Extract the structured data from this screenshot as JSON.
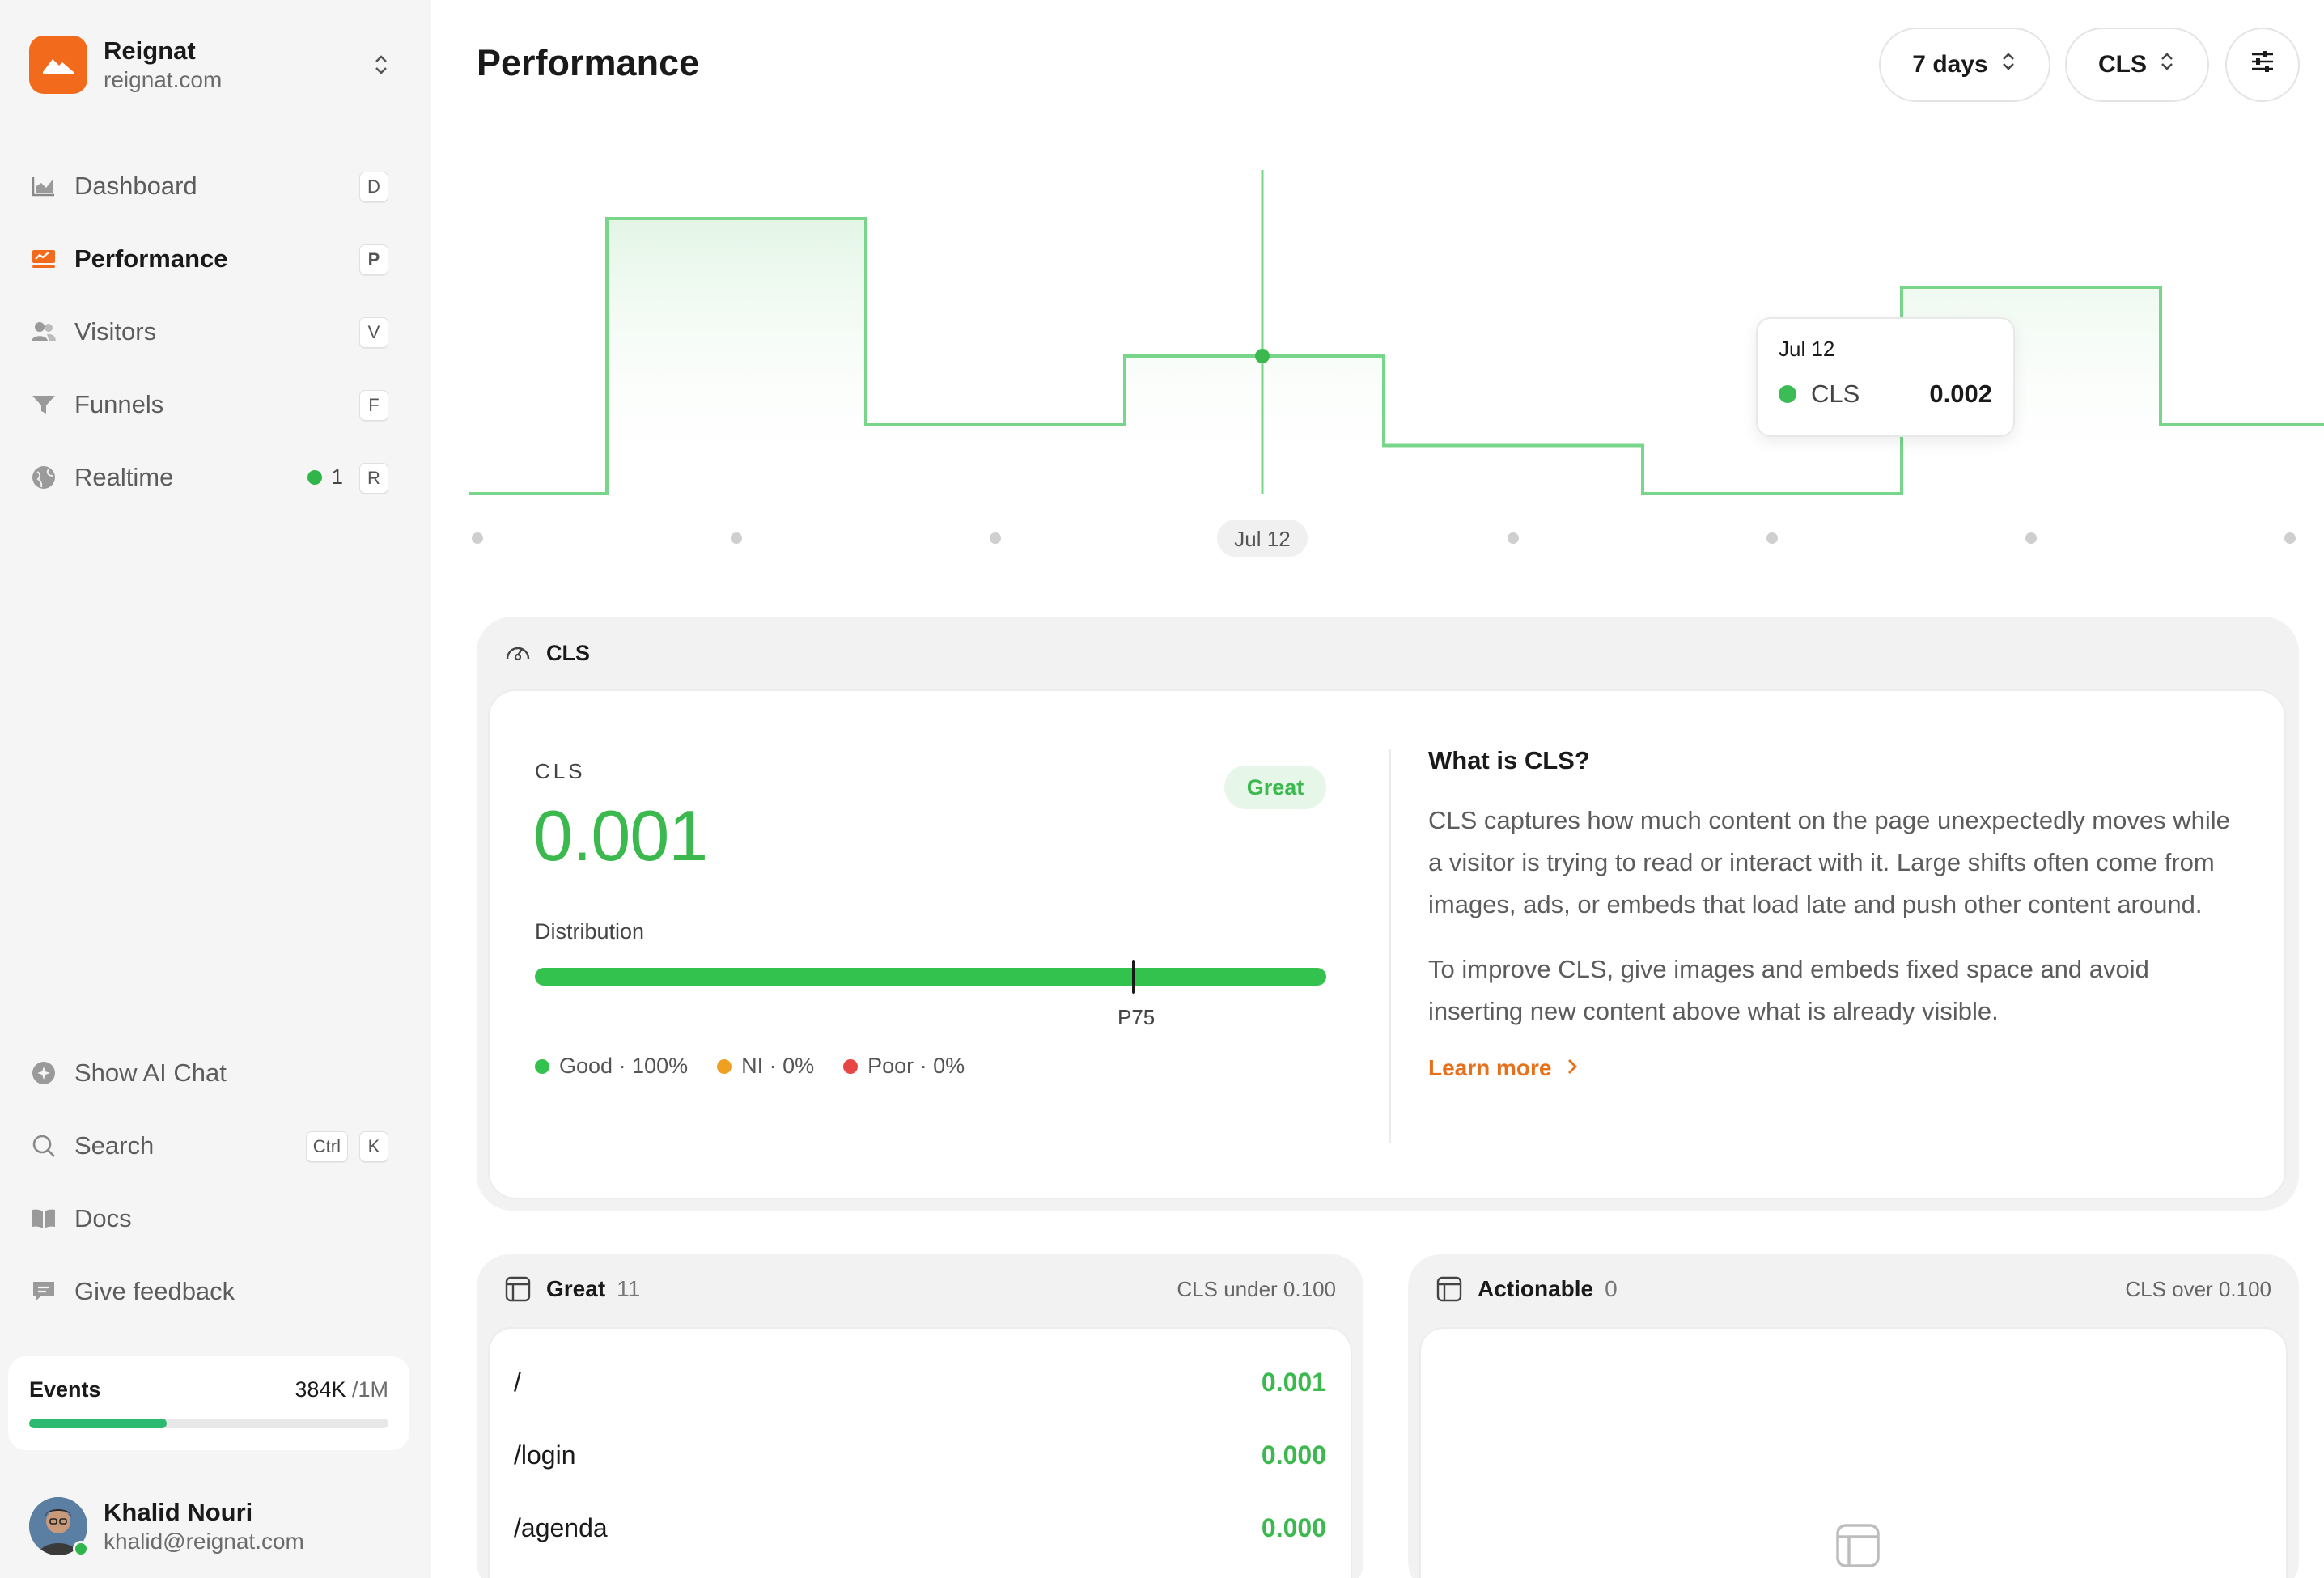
{
  "workspace": {
    "name": "Reignat",
    "domain": "reignat.com"
  },
  "nav": [
    {
      "label": "Dashboard",
      "key": "D",
      "icon": "chart-icon"
    },
    {
      "label": "Performance",
      "key": "P",
      "icon": "performance-icon",
      "active": true
    },
    {
      "label": "Visitors",
      "key": "V",
      "icon": "users-icon"
    },
    {
      "label": "Funnels",
      "key": "F",
      "icon": "funnel-icon"
    },
    {
      "label": "Realtime",
      "key": "R",
      "icon": "globe-icon",
      "count": "1"
    }
  ],
  "bottom_nav": {
    "ai_chat": "Show AI Chat",
    "search": "Search",
    "search_key1": "Ctrl",
    "search_key2": "K",
    "docs": "Docs",
    "feedback": "Give feedback"
  },
  "events": {
    "label": "Events",
    "used": "384K",
    "total": "/1M",
    "fraction": 0.384
  },
  "user": {
    "name": "Khalid Nouri",
    "email": "khalid@reignat.com"
  },
  "page": {
    "title": "Performance"
  },
  "controls": {
    "range": "7 days",
    "metric": "CLS"
  },
  "chart_data": {
    "type": "area",
    "metric": "CLS",
    "x_label_shown": "Jul 12",
    "steps": [
      0.0,
      0.004,
      0.001,
      0.002,
      0.0007,
      0.0,
      0.003,
      0.001
    ],
    "hover": {
      "date": "Jul 12",
      "series": "CLS",
      "value": "0.002"
    },
    "colors": {
      "line": "#78d68a",
      "fill": "#e3f5e6",
      "point": "#3cb94e"
    }
  },
  "cls_card": {
    "header": "CLS",
    "metric_label": "CLS",
    "value": "0.001",
    "badge": "Great",
    "distribution_label": "Distribution",
    "p75_label": "P75",
    "legend": [
      {
        "label": "Good · 100%",
        "color": "#34c24f"
      },
      {
        "label": "NI · 0%",
        "color": "#f0a020"
      },
      {
        "label": "Poor · 0%",
        "color": "#e84545"
      }
    ],
    "info_title": "What is CLS?",
    "info_p1": "CLS captures how much content on the page unexpectedly moves while a visitor is trying to read or interact with it. Large shifts often come from images, ads, or embeds that load late and push other content around.",
    "info_p2": "To improve CLS, give images and embeds fixed space and avoid inserting new content above what is already visible.",
    "learn_more": "Learn more"
  },
  "great_list": {
    "title": "Great",
    "count": "11",
    "note": "CLS under 0.100",
    "rows": [
      {
        "path": "/",
        "value": "0.001"
      },
      {
        "path": "/login",
        "value": "0.000"
      },
      {
        "path": "/agenda",
        "value": "0.000"
      }
    ]
  },
  "actionable_list": {
    "title": "Actionable",
    "count": "0",
    "note": "CLS over 0.100"
  }
}
